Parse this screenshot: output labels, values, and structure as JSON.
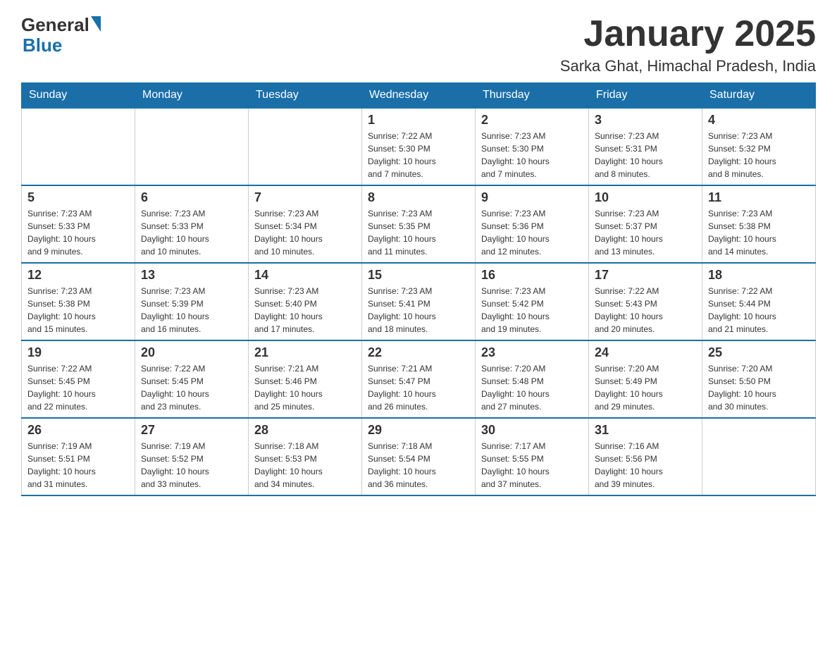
{
  "header": {
    "logo_general": "General",
    "logo_blue": "Blue",
    "title": "January 2025",
    "subtitle": "Sarka Ghat, Himachal Pradesh, India"
  },
  "calendar": {
    "days_of_week": [
      "Sunday",
      "Monday",
      "Tuesday",
      "Wednesday",
      "Thursday",
      "Friday",
      "Saturday"
    ],
    "weeks": [
      [
        {
          "day": "",
          "info": ""
        },
        {
          "day": "",
          "info": ""
        },
        {
          "day": "",
          "info": ""
        },
        {
          "day": "1",
          "info": "Sunrise: 7:22 AM\nSunset: 5:30 PM\nDaylight: 10 hours\nand 7 minutes."
        },
        {
          "day": "2",
          "info": "Sunrise: 7:23 AM\nSunset: 5:30 PM\nDaylight: 10 hours\nand 7 minutes."
        },
        {
          "day": "3",
          "info": "Sunrise: 7:23 AM\nSunset: 5:31 PM\nDaylight: 10 hours\nand 8 minutes."
        },
        {
          "day": "4",
          "info": "Sunrise: 7:23 AM\nSunset: 5:32 PM\nDaylight: 10 hours\nand 8 minutes."
        }
      ],
      [
        {
          "day": "5",
          "info": "Sunrise: 7:23 AM\nSunset: 5:33 PM\nDaylight: 10 hours\nand 9 minutes."
        },
        {
          "day": "6",
          "info": "Sunrise: 7:23 AM\nSunset: 5:33 PM\nDaylight: 10 hours\nand 10 minutes."
        },
        {
          "day": "7",
          "info": "Sunrise: 7:23 AM\nSunset: 5:34 PM\nDaylight: 10 hours\nand 10 minutes."
        },
        {
          "day": "8",
          "info": "Sunrise: 7:23 AM\nSunset: 5:35 PM\nDaylight: 10 hours\nand 11 minutes."
        },
        {
          "day": "9",
          "info": "Sunrise: 7:23 AM\nSunset: 5:36 PM\nDaylight: 10 hours\nand 12 minutes."
        },
        {
          "day": "10",
          "info": "Sunrise: 7:23 AM\nSunset: 5:37 PM\nDaylight: 10 hours\nand 13 minutes."
        },
        {
          "day": "11",
          "info": "Sunrise: 7:23 AM\nSunset: 5:38 PM\nDaylight: 10 hours\nand 14 minutes."
        }
      ],
      [
        {
          "day": "12",
          "info": "Sunrise: 7:23 AM\nSunset: 5:38 PM\nDaylight: 10 hours\nand 15 minutes."
        },
        {
          "day": "13",
          "info": "Sunrise: 7:23 AM\nSunset: 5:39 PM\nDaylight: 10 hours\nand 16 minutes."
        },
        {
          "day": "14",
          "info": "Sunrise: 7:23 AM\nSunset: 5:40 PM\nDaylight: 10 hours\nand 17 minutes."
        },
        {
          "day": "15",
          "info": "Sunrise: 7:23 AM\nSunset: 5:41 PM\nDaylight: 10 hours\nand 18 minutes."
        },
        {
          "day": "16",
          "info": "Sunrise: 7:23 AM\nSunset: 5:42 PM\nDaylight: 10 hours\nand 19 minutes."
        },
        {
          "day": "17",
          "info": "Sunrise: 7:22 AM\nSunset: 5:43 PM\nDaylight: 10 hours\nand 20 minutes."
        },
        {
          "day": "18",
          "info": "Sunrise: 7:22 AM\nSunset: 5:44 PM\nDaylight: 10 hours\nand 21 minutes."
        }
      ],
      [
        {
          "day": "19",
          "info": "Sunrise: 7:22 AM\nSunset: 5:45 PM\nDaylight: 10 hours\nand 22 minutes."
        },
        {
          "day": "20",
          "info": "Sunrise: 7:22 AM\nSunset: 5:45 PM\nDaylight: 10 hours\nand 23 minutes."
        },
        {
          "day": "21",
          "info": "Sunrise: 7:21 AM\nSunset: 5:46 PM\nDaylight: 10 hours\nand 25 minutes."
        },
        {
          "day": "22",
          "info": "Sunrise: 7:21 AM\nSunset: 5:47 PM\nDaylight: 10 hours\nand 26 minutes."
        },
        {
          "day": "23",
          "info": "Sunrise: 7:20 AM\nSunset: 5:48 PM\nDaylight: 10 hours\nand 27 minutes."
        },
        {
          "day": "24",
          "info": "Sunrise: 7:20 AM\nSunset: 5:49 PM\nDaylight: 10 hours\nand 29 minutes."
        },
        {
          "day": "25",
          "info": "Sunrise: 7:20 AM\nSunset: 5:50 PM\nDaylight: 10 hours\nand 30 minutes."
        }
      ],
      [
        {
          "day": "26",
          "info": "Sunrise: 7:19 AM\nSunset: 5:51 PM\nDaylight: 10 hours\nand 31 minutes."
        },
        {
          "day": "27",
          "info": "Sunrise: 7:19 AM\nSunset: 5:52 PM\nDaylight: 10 hours\nand 33 minutes."
        },
        {
          "day": "28",
          "info": "Sunrise: 7:18 AM\nSunset: 5:53 PM\nDaylight: 10 hours\nand 34 minutes."
        },
        {
          "day": "29",
          "info": "Sunrise: 7:18 AM\nSunset: 5:54 PM\nDaylight: 10 hours\nand 36 minutes."
        },
        {
          "day": "30",
          "info": "Sunrise: 7:17 AM\nSunset: 5:55 PM\nDaylight: 10 hours\nand 37 minutes."
        },
        {
          "day": "31",
          "info": "Sunrise: 7:16 AM\nSunset: 5:56 PM\nDaylight: 10 hours\nand 39 minutes."
        },
        {
          "day": "",
          "info": ""
        }
      ]
    ]
  }
}
